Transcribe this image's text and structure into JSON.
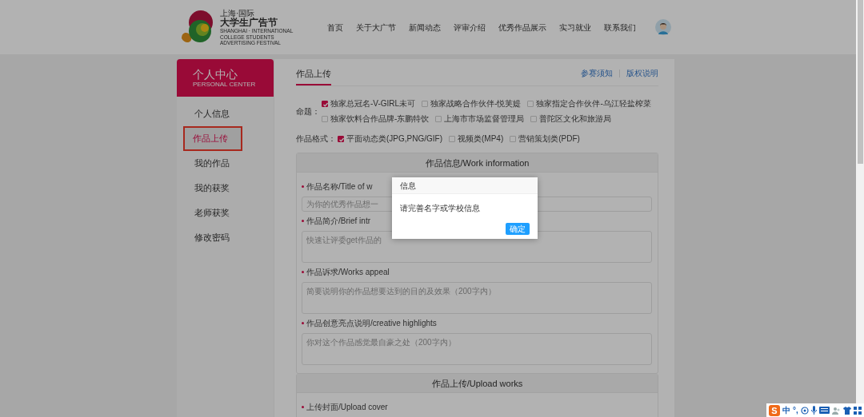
{
  "header": {
    "logo": {
      "lines": [
        "上海·国际",
        "大学生广告节",
        "SHANGHAI · INTERNATIONAL",
        "COLLEGE STUDENTS",
        "ADVERTISING FESTIVAL"
      ]
    },
    "nav": [
      {
        "label": "首页"
      },
      {
        "label": "关于大广节"
      },
      {
        "label": "新闻动态"
      },
      {
        "label": "评审介绍"
      },
      {
        "label": "优秀作品展示"
      },
      {
        "label": "实习就业"
      },
      {
        "label": "联系我们"
      }
    ]
  },
  "sidebar": {
    "title": "个人中心",
    "subtitle": "PERSONAL CENTER",
    "items": [
      {
        "label": "个人信息",
        "selected": false,
        "highlighted": false
      },
      {
        "label": "作品上传",
        "selected": true,
        "highlighted": true
      },
      {
        "label": "我的作品",
        "selected": false,
        "highlighted": false
      },
      {
        "label": "我的获奖",
        "selected": false,
        "highlighted": false
      },
      {
        "label": "老师获奖",
        "selected": false,
        "highlighted": false
      },
      {
        "label": "修改密码",
        "selected": false,
        "highlighted": false
      }
    ]
  },
  "panel": {
    "tab": "作品上传",
    "links": [
      "参赛须知",
      "版权说明"
    ],
    "topics": {
      "label": "命题：",
      "options": [
        {
          "label": "独家总冠名-V-GIRL未可",
          "checked": true
        },
        {
          "label": "独家战略合作伙伴-悦芙媞",
          "checked": false
        },
        {
          "label": "独家指定合作伙伴-乌江轻盐榨菜",
          "checked": false
        },
        {
          "label": "独家饮料合作品牌-东鹏特饮",
          "checked": false
        },
        {
          "label": "上海市市场监督管理局",
          "checked": false
        },
        {
          "label": "普陀区文化和旅游局",
          "checked": false
        }
      ]
    },
    "formats": {
      "label": "作品格式：",
      "options": [
        {
          "label": "平面动态类(JPG,PNG/GIF)",
          "checked": true
        },
        {
          "label": "视频类(MP4)",
          "checked": false
        },
        {
          "label": "营销策划类(PDF)",
          "checked": false
        }
      ]
    },
    "sections": [
      {
        "title": "作品信息/Work information",
        "fields": [
          {
            "label": "作品名称/Title of w",
            "required": true,
            "kind": "input",
            "placeholder": "为你的优秀作品想一"
          },
          {
            "label": "作品简介/Brief intr",
            "required": true,
            "kind": "textarea",
            "placeholder": "快速让评委get作品的"
          },
          {
            "label": "作品诉求/Works appeal",
            "required": true,
            "kind": "textarea",
            "placeholder": "简要说明你的作品想要达到的目的及效果（200字内）"
          },
          {
            "label": "作品创意亮点说明/creative highlights",
            "required": true,
            "kind": "textarea",
            "placeholder": "你对这个作品感觉最自豪之处（200字内）"
          }
        ]
      },
      {
        "title": "作品上传/Upload works",
        "fields": [
          {
            "label": "上传封面/Upload cover",
            "required": true,
            "kind": "label"
          }
        ]
      }
    ]
  },
  "dialog": {
    "title": "信息",
    "message": "请完善名字或学校信息",
    "button": "确定"
  },
  "ime_bar": {
    "logo": "S",
    "items": [
      "中",
      "°,"
    ]
  }
}
